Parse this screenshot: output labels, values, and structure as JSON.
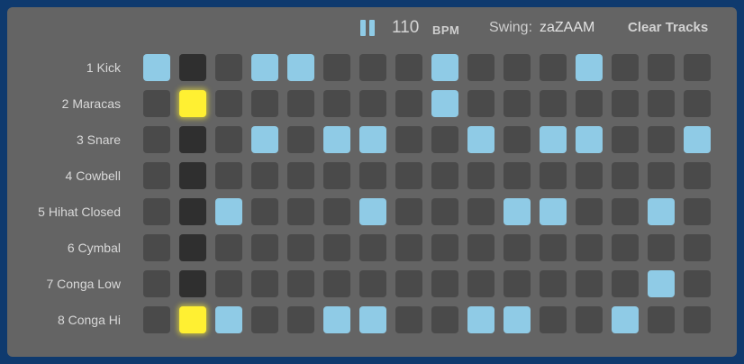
{
  "controls": {
    "pause_icon": "pause-icon",
    "bpm_value": "110",
    "bpm_unit": "BPM",
    "swing_label": "Swing:",
    "swing_value": "zaZAAM",
    "clear_label": "Clear Tracks"
  },
  "colors": {
    "background": "#0f3a6e",
    "panel": "#646464",
    "step_off": "#4a4a4a",
    "step_on": "#8fcbe6",
    "playhead_column": "#2f2f2f",
    "active_hit": "#fff032"
  },
  "playhead_step": 2,
  "tracks": [
    {
      "label": "1 Kick",
      "steps": [
        1,
        0,
        0,
        1,
        1,
        0,
        0,
        0,
        1,
        0,
        0,
        0,
        1,
        0,
        0,
        0
      ]
    },
    {
      "label": "2 Maracas",
      "steps": [
        0,
        1,
        0,
        0,
        0,
        0,
        0,
        0,
        1,
        0,
        0,
        0,
        0,
        0,
        0,
        0
      ]
    },
    {
      "label": "3 Snare",
      "steps": [
        0,
        0,
        0,
        1,
        0,
        1,
        1,
        0,
        0,
        1,
        0,
        1,
        1,
        0,
        0,
        1
      ]
    },
    {
      "label": "4 Cowbell",
      "steps": [
        0,
        0,
        0,
        0,
        0,
        0,
        0,
        0,
        0,
        0,
        0,
        0,
        0,
        0,
        0,
        0
      ]
    },
    {
      "label": "5 Hihat Closed",
      "steps": [
        0,
        0,
        1,
        0,
        0,
        0,
        1,
        0,
        0,
        0,
        1,
        1,
        0,
        0,
        1,
        0
      ]
    },
    {
      "label": "6 Cymbal",
      "steps": [
        0,
        0,
        0,
        0,
        0,
        0,
        0,
        0,
        0,
        0,
        0,
        0,
        0,
        0,
        0,
        0
      ]
    },
    {
      "label": "7 Conga Low",
      "steps": [
        0,
        0,
        0,
        0,
        0,
        0,
        0,
        0,
        0,
        0,
        0,
        0,
        0,
        0,
        1,
        0
      ]
    },
    {
      "label": "8 Conga Hi",
      "steps": [
        0,
        1,
        1,
        0,
        0,
        1,
        1,
        0,
        0,
        1,
        1,
        0,
        0,
        1,
        0,
        0
      ]
    }
  ]
}
